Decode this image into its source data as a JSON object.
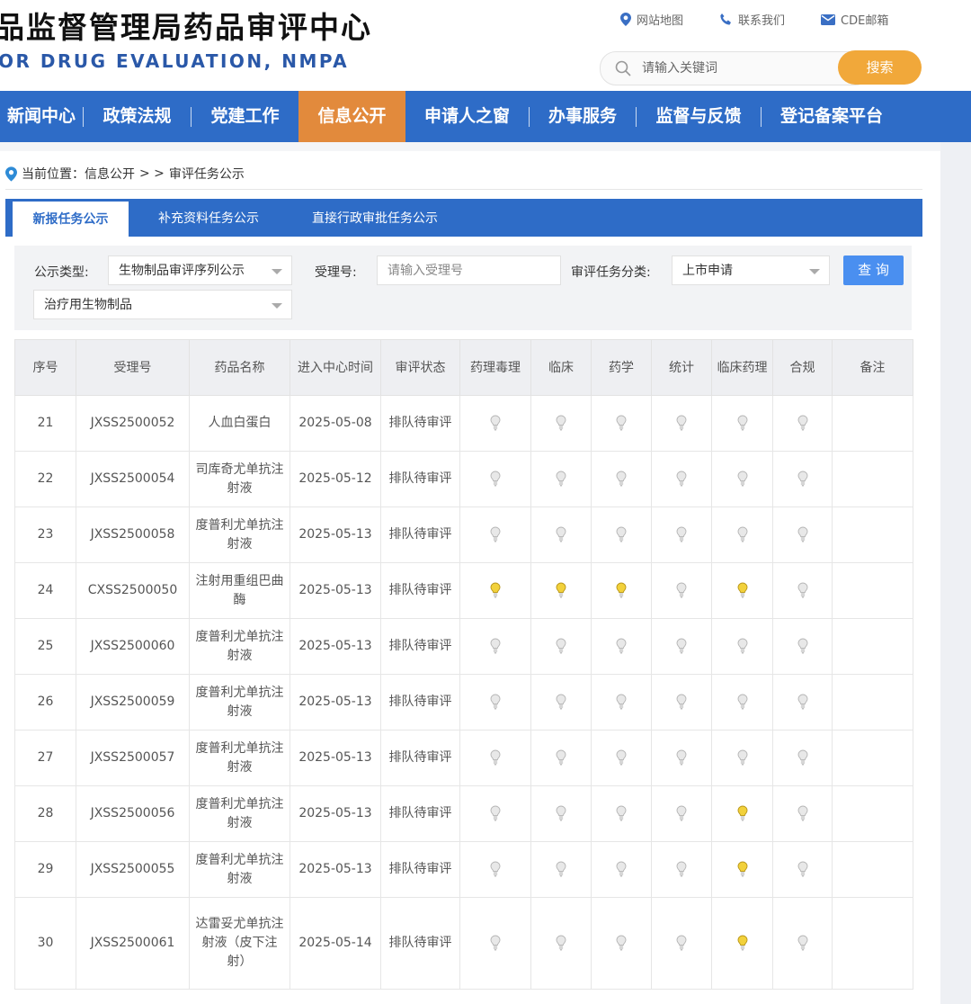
{
  "header": {
    "logo_cn": "品监督管理局药品审评中心",
    "logo_en": "OR DRUG EVALUATION, NMPA",
    "links": [
      "网站地图",
      "联系我们",
      "CDE邮箱"
    ],
    "search_placeholder": "请输入关键词",
    "search_button": "搜索"
  },
  "nav": {
    "items": [
      "新闻中心",
      "政策法规",
      "党建工作",
      "信息公开",
      "申请人之窗",
      "办事服务",
      "监督与反馈",
      "登记备案平台"
    ],
    "active": "信息公开"
  },
  "breadcrumb": {
    "prefix": "当前位置：信息公开",
    "sep": "> >",
    "current": "审评任务公示"
  },
  "tabs": [
    "新报任务公示",
    "补充资料任务公示",
    "直接行政审批任务公示"
  ],
  "filters": {
    "type_label": "公示类型:",
    "type_value": "生物制品审评序列公示",
    "accept_label": "受理号:",
    "accept_placeholder": "请输入受理号",
    "category_label": "审评任务分类:",
    "category_value": "上市申请",
    "subtype_value": "治疗用生物制品",
    "query_button": "查 询"
  },
  "table": {
    "headers": [
      "序号",
      "受理号",
      "药品名称",
      "进入中心时间",
      "审评状态",
      "药理毒理",
      "临床",
      "药学",
      "统计",
      "临床药理",
      "合规",
      "备注"
    ],
    "rows": [
      {
        "no": "21",
        "acc": "JXSS2500052",
        "name": "人血白蛋白",
        "date": "2025-05-08",
        "status": "排队待审评",
        "flags": [
          0,
          0,
          0,
          0,
          0,
          0
        ]
      },
      {
        "no": "22",
        "acc": "JXSS2500054",
        "name": "司库奇尤单抗注射液",
        "date": "2025-05-12",
        "status": "排队待审评",
        "flags": [
          0,
          0,
          0,
          0,
          0,
          0
        ]
      },
      {
        "no": "23",
        "acc": "JXSS2500058",
        "name": "度普利尤单抗注射液",
        "date": "2025-05-13",
        "status": "排队待审评",
        "flags": [
          0,
          0,
          0,
          0,
          0,
          0
        ]
      },
      {
        "no": "24",
        "acc": "CXSS2500050",
        "name": "注射用重组巴曲酶",
        "date": "2025-05-13",
        "status": "排队待审评",
        "flags": [
          1,
          1,
          1,
          0,
          1,
          0
        ]
      },
      {
        "no": "25",
        "acc": "JXSS2500060",
        "name": "度普利尤单抗注射液",
        "date": "2025-05-13",
        "status": "排队待审评",
        "flags": [
          0,
          0,
          0,
          0,
          0,
          0
        ]
      },
      {
        "no": "26",
        "acc": "JXSS2500059",
        "name": "度普利尤单抗注射液",
        "date": "2025-05-13",
        "status": "排队待审评",
        "flags": [
          0,
          0,
          0,
          0,
          0,
          0
        ]
      },
      {
        "no": "27",
        "acc": "JXSS2500057",
        "name": "度普利尤单抗注射液",
        "date": "2025-05-13",
        "status": "排队待审评",
        "flags": [
          0,
          0,
          0,
          0,
          0,
          0
        ]
      },
      {
        "no": "28",
        "acc": "JXSS2500056",
        "name": "度普利尤单抗注射液",
        "date": "2025-05-13",
        "status": "排队待审评",
        "flags": [
          0,
          0,
          0,
          0,
          1,
          0
        ]
      },
      {
        "no": "29",
        "acc": "JXSS2500055",
        "name": "度普利尤单抗注射液",
        "date": "2025-05-13",
        "status": "排队待审评",
        "flags": [
          0,
          0,
          0,
          0,
          1,
          0
        ]
      },
      {
        "no": "30",
        "acc": "JXSS2500061",
        "name": "达雷妥尤单抗注射液（皮下注射）",
        "date": "2025-05-14",
        "status": "排队待审评",
        "flags": [
          0,
          0,
          0,
          0,
          1,
          0
        ]
      }
    ]
  },
  "colors": {
    "primary": "#2e6cc7",
    "nav_active": "#e28a3c",
    "search_button": "#f1a83a",
    "query_button": "#4a8ff0",
    "bulb_on": "#f2d13b",
    "bulb_off": "#e8e8e8"
  },
  "icons": {
    "links": [
      "map-pin-icon",
      "phone-icon",
      "mail-icon"
    ],
    "search": "search-icon",
    "breadcrumb": "location-pin-icon",
    "status": "lightbulb-icon"
  }
}
